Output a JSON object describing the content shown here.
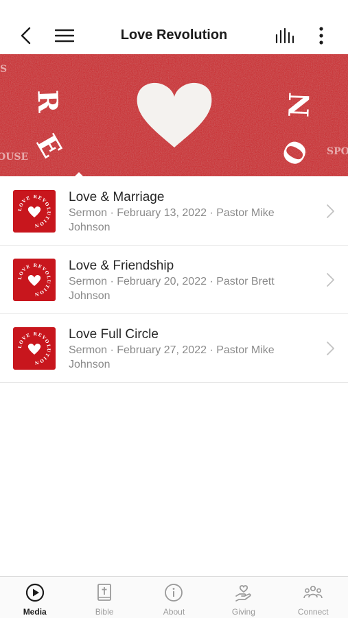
{
  "status_bar": {
    "time": ""
  },
  "header": {
    "title": "Love Revolution",
    "back_icon": "back-arrow-icon",
    "menu_icon": "hamburger-menu-icon",
    "audio_icon": "audio-bars-icon",
    "more_icon": "more-vertical-icon"
  },
  "hero": {
    "letters_left": [
      "R",
      "E"
    ],
    "letters_right": [
      "N",
      "O"
    ],
    "edge_text_left_top": "S",
    "edge_text_left_bottom": "OUSE",
    "edge_text_right_bottom": "SPO",
    "colors": {
      "felt": "#cc2127",
      "heart": "#f4f2ef"
    }
  },
  "thumbnail": {
    "ring_text": "LOVE REVOLUTION",
    "colors": {
      "background": "#c8161d",
      "text": "#ffffff"
    }
  },
  "sermons": [
    {
      "title": "Love & Marriage",
      "meta": "Sermon · February 13, 2022 · Pastor Mike Johnson"
    },
    {
      "title": "Love & Friendship",
      "meta": "Sermon · February 20, 2022 · Pastor Brett Johnson"
    },
    {
      "title": "Love Full Circle",
      "meta": "Sermon · February 27, 2022 · Pastor Mike Johnson"
    }
  ],
  "tabs": [
    {
      "label": "Media",
      "icon": "play-circle-icon",
      "active": true
    },
    {
      "label": "Bible",
      "icon": "bible-icon",
      "active": false
    },
    {
      "label": "About",
      "icon": "info-icon",
      "active": false
    },
    {
      "label": "Giving",
      "icon": "giving-hand-heart-icon",
      "active": false
    },
    {
      "label": "Connect",
      "icon": "people-group-icon",
      "active": false
    }
  ]
}
